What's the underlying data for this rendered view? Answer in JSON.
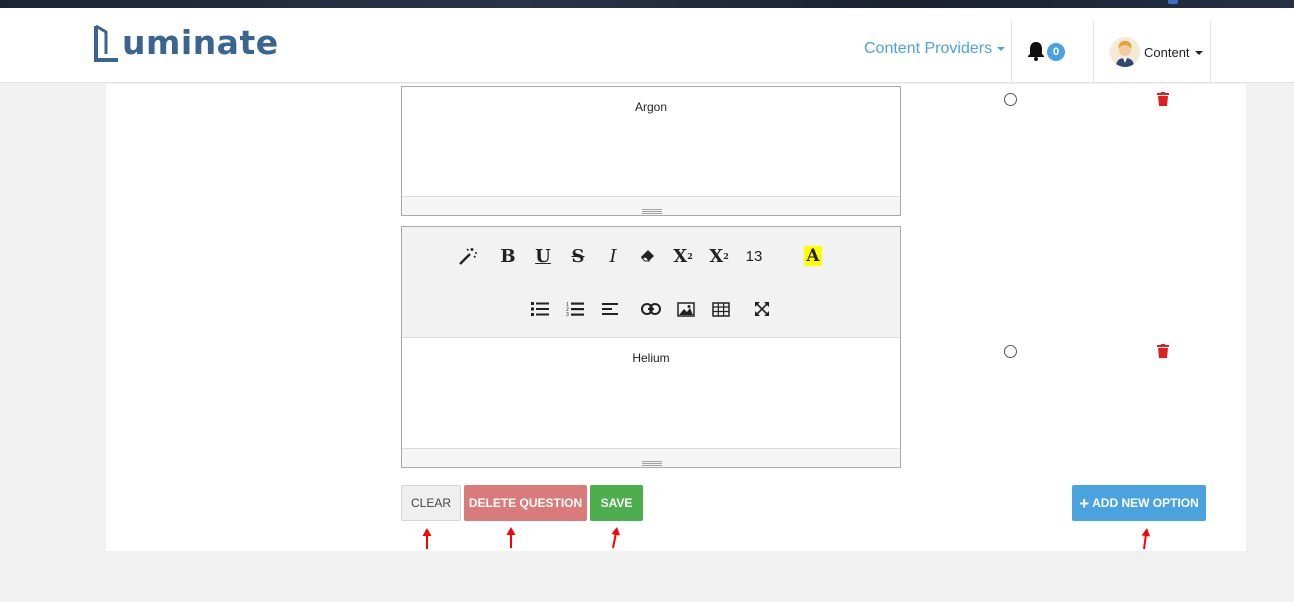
{
  "brand": {
    "name": "uminate"
  },
  "navbar": {
    "providers_label": "Content Providers",
    "notification_count": "0",
    "user_label": "Content"
  },
  "options": [
    {
      "text": "Argon"
    },
    {
      "text": "Helium"
    }
  ],
  "toolbar": {
    "font_size": "13"
  },
  "buttons": {
    "clear": "CLEAR",
    "delete_question": "DELETE QUESTION",
    "save": "SAVE",
    "add_option": "ADD NEW OPTION"
  },
  "colors": {
    "accent": "#4aa3df",
    "danger": "#d97b7b",
    "success": "#4cae4c",
    "trash": "#e0201f",
    "annotation": "#ff0000"
  }
}
